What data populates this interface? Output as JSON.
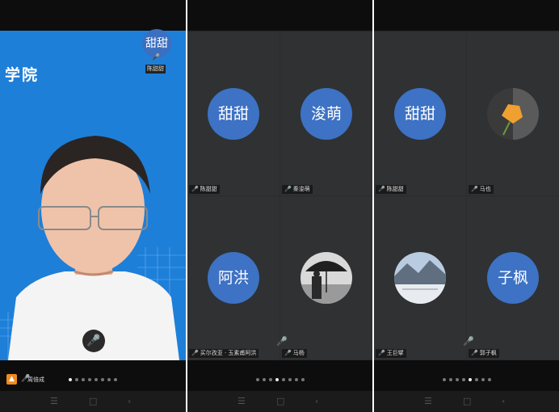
{
  "phone1": {
    "background_text": "学院",
    "thumbnail": {
      "avatar_text": "甜甜",
      "name": "陈甜甜"
    },
    "self_name": "周倍成",
    "page_dots": 8,
    "active_dot": 0
  },
  "phone2": {
    "tiles": [
      {
        "avatar_text": "甜甜",
        "name": "陈甜甜"
      },
      {
        "avatar_text": "浚萌",
        "name": "秦浚萌"
      },
      {
        "avatar_text": "阿洪",
        "name": "买尔孜亚 · 玉素甫阿洪"
      },
      {
        "avatar_text": "",
        "name": "马杨"
      }
    ],
    "page_dots": 8,
    "active_dot": 3
  },
  "phone3": {
    "tiles": [
      {
        "avatar_text": "甜甜",
        "name": "陈甜甜"
      },
      {
        "avatar_text": "",
        "name": "马也"
      },
      {
        "avatar_text": "",
        "name": "王巨擘"
      },
      {
        "avatar_text": "子枫",
        "name": "郭子枫"
      }
    ],
    "page_dots": 8,
    "active_dot": 4
  },
  "colors": {
    "avatar_blue": "#3d72c4",
    "speaker_bg": "#1e7fd8",
    "mic_active": "#3cb043"
  },
  "icons": {
    "mic": "microphone-icon",
    "back": "back-chevron-icon",
    "home": "home-square-icon",
    "menu": "menu-lines-icon"
  }
}
